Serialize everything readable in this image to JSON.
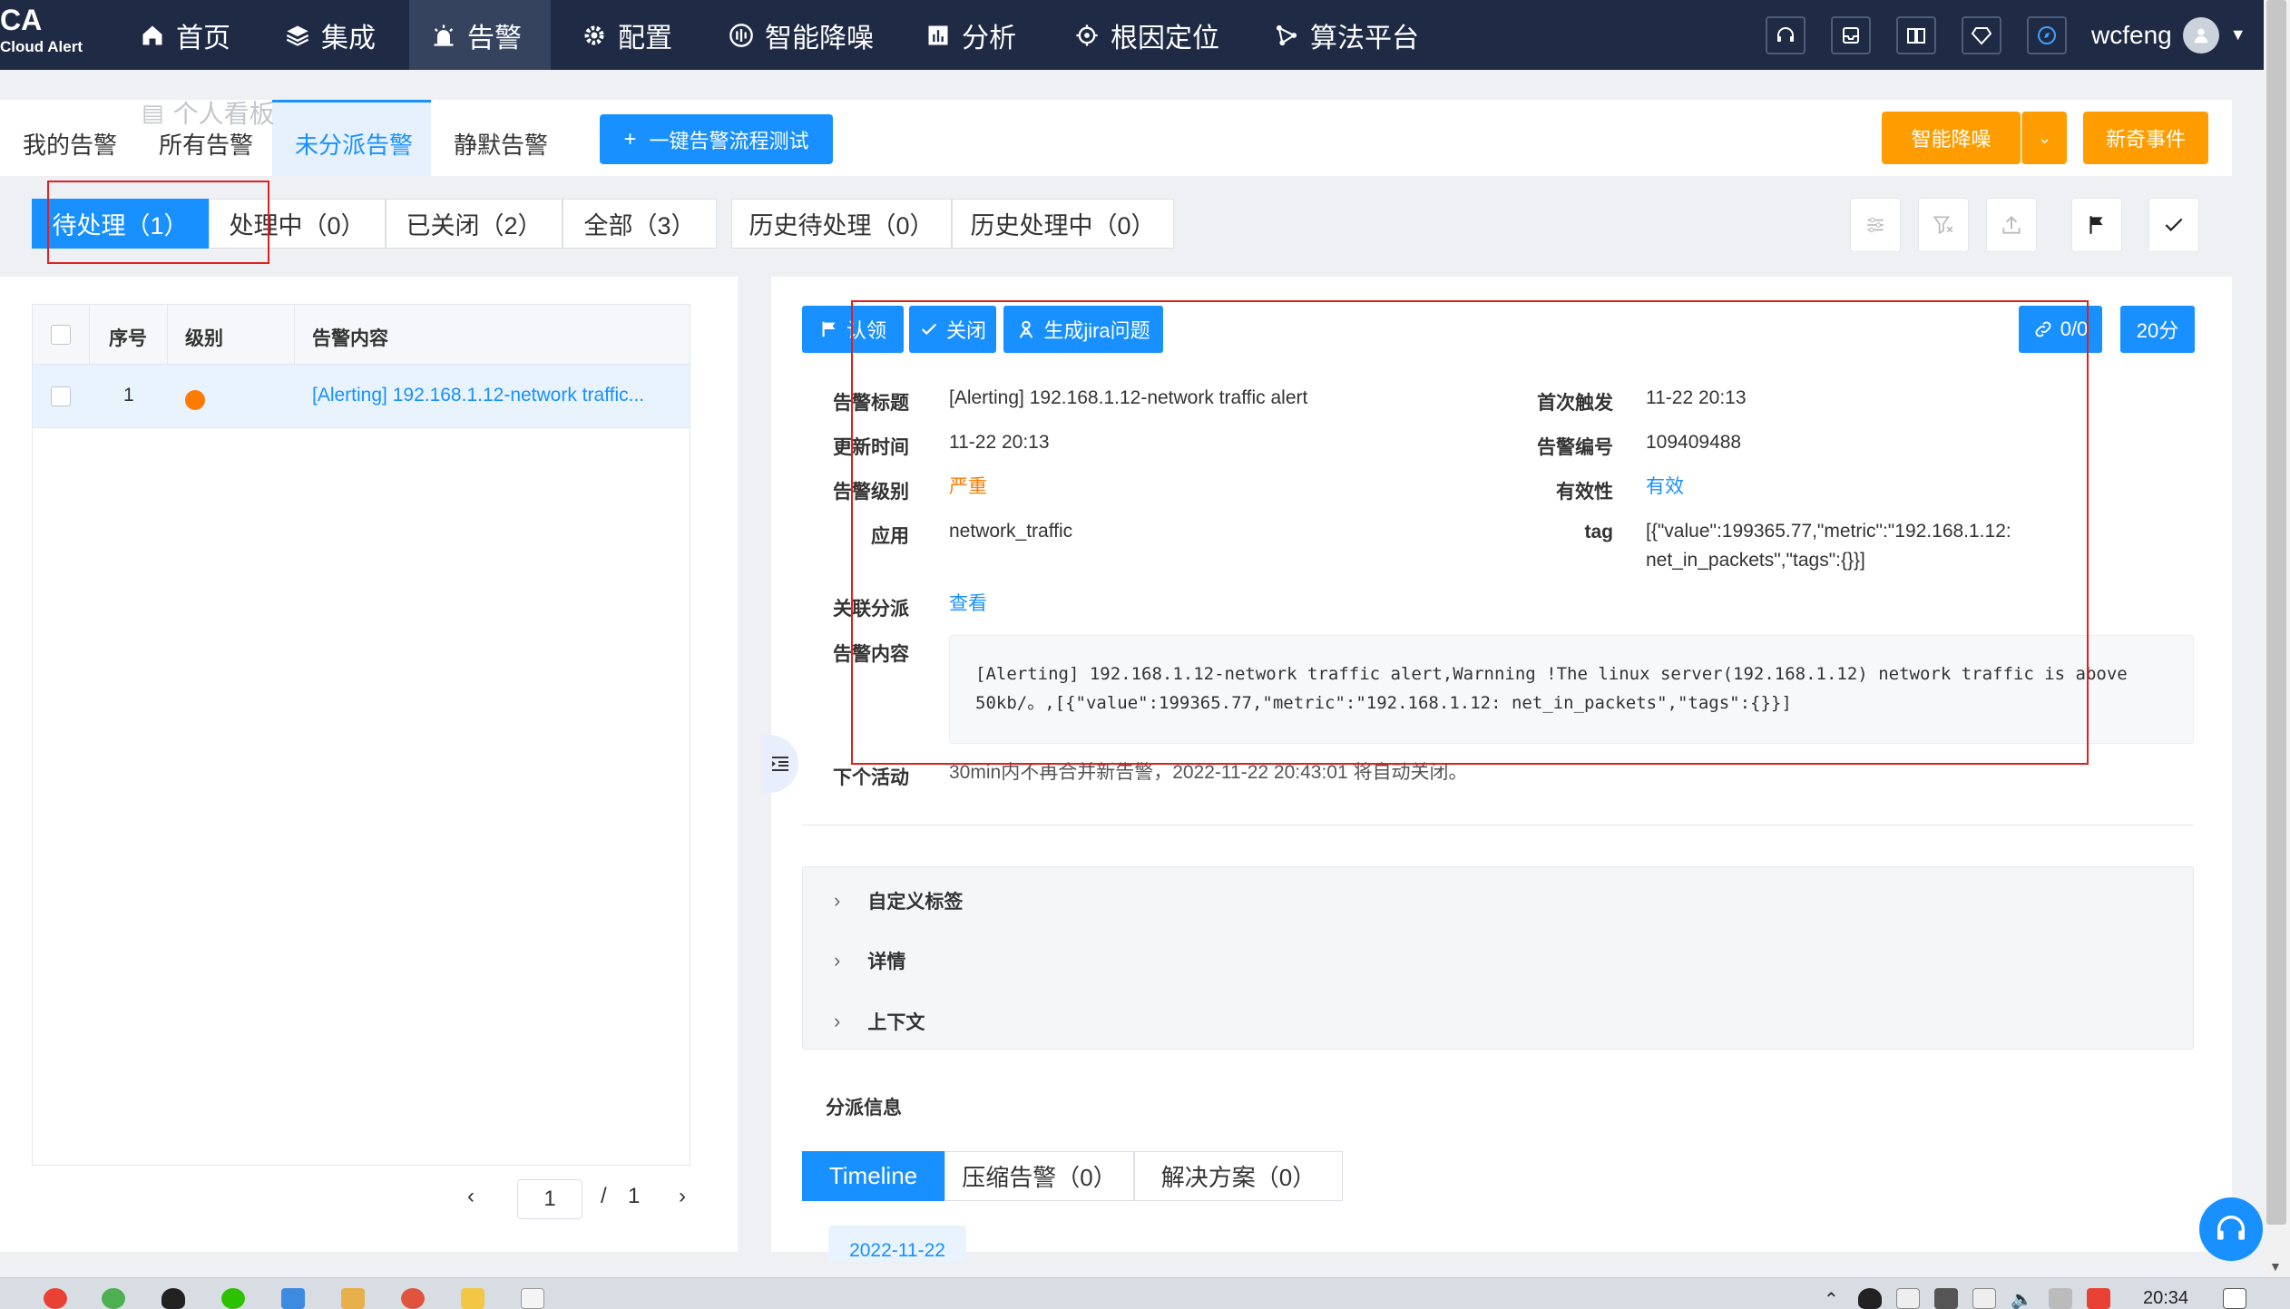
{
  "app": {
    "logo": "CA",
    "logo_sub": "Cloud Alert"
  },
  "nav": {
    "items": [
      {
        "label": "首页",
        "icon": "home-icon"
      },
      {
        "label": "集成",
        "icon": "layers-icon"
      },
      {
        "label": "告警",
        "icon": "alarm-icon",
        "active": true
      },
      {
        "label": "配置",
        "icon": "gear-icon"
      },
      {
        "label": "智能降噪",
        "icon": "noise-reduction-icon"
      },
      {
        "label": "分析",
        "icon": "bar-chart-icon"
      },
      {
        "label": "根因定位",
        "icon": "locate-icon"
      },
      {
        "label": "算法平台",
        "icon": "algorithm-icon"
      }
    ],
    "tools": [
      "support-icon",
      "inbox-icon",
      "book-icon",
      "diamond-icon",
      "compass-icon"
    ],
    "user": "wcfeng"
  },
  "module_tabs": [
    "我的告警",
    "所有告警",
    "未分派告警",
    "静默告警"
  ],
  "ghost_label": "个人看板",
  "buttons": {
    "flow_test": "一键告警流程测试",
    "smart_noise": "智能降噪",
    "new_event": "新奇事件"
  },
  "status_tabs": [
    "待处理（1）",
    "处理中（0）",
    "已关闭（2）",
    "全部（3）",
    "历史待处理（0）",
    "历史处理中（0）"
  ],
  "table": {
    "headers": [
      "序号",
      "级别",
      "告警内容"
    ],
    "rows": [
      {
        "index": "1",
        "level_color": "#ff7a00",
        "content": "[Alerting] 192.168.1.12-network traffic..."
      }
    ]
  },
  "pager": {
    "current": "1",
    "sep": "/",
    "total": "1",
    "prev": "‹",
    "next": "›"
  },
  "detail": {
    "actions": {
      "claim": "认领",
      "close": "关闭",
      "jira": "生成jira问题",
      "link": "0/0",
      "time": "20分"
    },
    "fields": {
      "title_label": "告警标题",
      "title": "[Alerting] 192.168.1.12-network traffic alert",
      "first_label": "首次触发",
      "first": "11-22 20:13",
      "update_label": "更新时间",
      "update": "11-22 20:13",
      "id_label": "告警编号",
      "id": "109409488",
      "level_label": "告警级别",
      "level": "严重",
      "level_color": "#ff7a00",
      "valid_label": "有效性",
      "valid": "有效",
      "app_label": "应用",
      "app": "network_traffic",
      "tag_label": "tag",
      "tag_line1": "[{\"value\":199365.77,\"metric\":\"192.168.1.12:",
      "tag_line2": "net_in_packets\",\"tags\":{}}]",
      "assign_label": "关联分派",
      "assign": "查看",
      "content_label": "告警内容",
      "content_line1": "[Alerting] 192.168.1.12-network traffic alert,Warnning !The linux server(192.168.1.12) network traffic is above",
      "content_line2": "50kb/。,[{\"value\":199365.77,\"metric\":\"192.168.1.12: net_in_packets\",\"tags\":{}}]",
      "next_label": "下个活动",
      "next": "30min内不再合并新告警，2022-11-22 20:43:01 将自动关闭。"
    },
    "accordion": [
      "自定义标签",
      "详情",
      "上下文"
    ],
    "assign_section": "分派信息",
    "bottom_tabs": [
      "Timeline",
      "压缩告警（0）",
      "解决方案（0）"
    ],
    "timeline_date": "2022-11-22"
  },
  "taskbar": {
    "clock": "20:34"
  },
  "colors": {
    "nav_bg": "#1f2b45",
    "primary": "#1890ff",
    "orange": "#ff9d00",
    "highlight": "#e02020"
  }
}
